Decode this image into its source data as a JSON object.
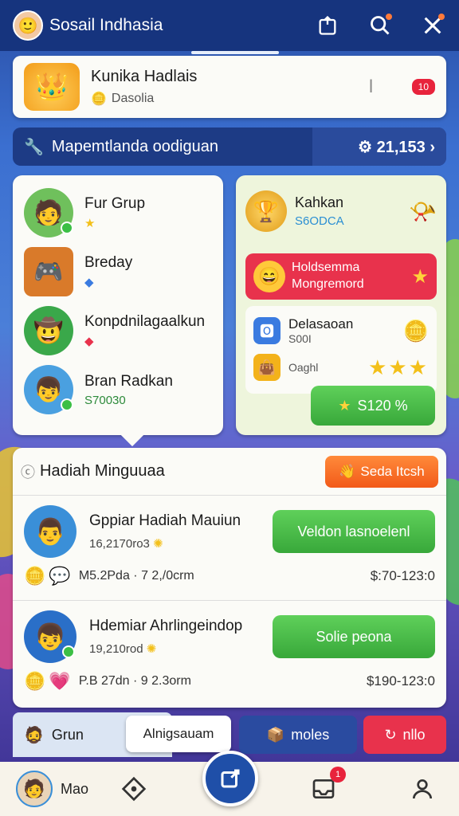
{
  "app": {
    "title": "Sosail Indhasia",
    "avatar_icon": "user-avatar-icon"
  },
  "header_icons": [
    "share-icon",
    "search-icon",
    "close-icon"
  ],
  "profile": {
    "name": "Kunika Hadlais",
    "sub_label": "Dasolia",
    "notification_count": "10"
  },
  "search": {
    "label": "Mapemtlanda oodiguan",
    "count": "21,153"
  },
  "friends": [
    {
      "name": "Fur Grup",
      "sub": ""
    },
    {
      "name": "Breday",
      "sub": ""
    },
    {
      "name": "Konpdnilagaalkun",
      "sub": ""
    },
    {
      "name": "Bran Radkan",
      "sub": "S70030"
    }
  ],
  "rewards": {
    "title": "Kahkan",
    "subtitle": "S6ODCA",
    "promo_line1": "Holdsemma",
    "promo_line2": "Mongremord",
    "task_title": "Delasaoan",
    "task_sub": "S00I",
    "task_label": "Oaghl",
    "claim_label": "S120 %"
  },
  "weekly": {
    "title": "Hadiah Minguuaa",
    "cta_label": "Seda Itcsh",
    "rows": [
      {
        "name": "Gppiar Hadiah Mauiun",
        "sub": "16,2170ro3",
        "button": "Veldon lasnoelenl",
        "meta": "M5.2Pda · 7   2,/0crm",
        "price": "$:70-123:0"
      },
      {
        "name": "Hdemiar Ahrlingeindop",
        "sub": "19,210rod",
        "button": "Solie peona",
        "meta": "P.B 27dn · 9   2.3orm",
        "price": "$190-123:0"
      }
    ]
  },
  "strip": {
    "grun": "Grun",
    "tooltip": "Alnigsauam",
    "modes": "moles",
    "nlo": "nllo"
  },
  "bottom_nav": {
    "me_label": "Mao",
    "badge": "1"
  },
  "colors": {
    "primary": "#16347e",
    "accent_green": "#38a83a",
    "accent_red": "#e8324c",
    "accent_orange": "#f25a19"
  }
}
